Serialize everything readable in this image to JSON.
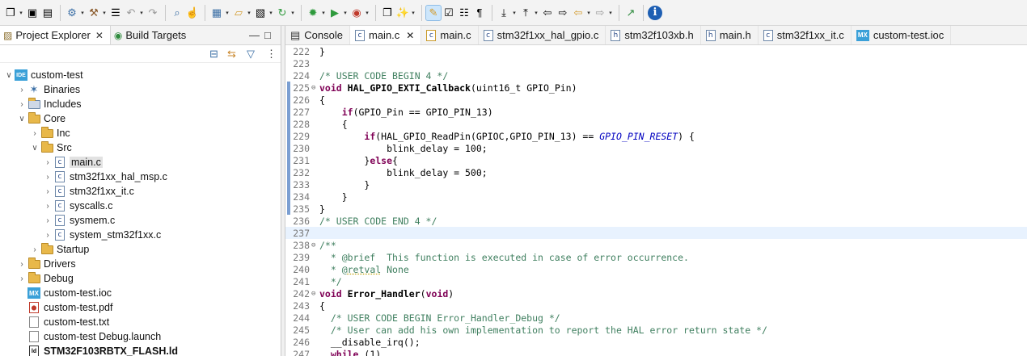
{
  "toolbar": {
    "buttons": [
      {
        "icon": "new-icon",
        "glyph": "❐",
        "arrow": true
      },
      {
        "icon": "save-icon",
        "glyph": "▣"
      },
      {
        "icon": "save-all-icon",
        "glyph": "▤"
      },
      {
        "sep": true
      },
      {
        "icon": "settings-icon",
        "glyph": "⚙",
        "arrow": true
      },
      {
        "icon": "build-icon",
        "glyph": "⚒",
        "arrow": true
      },
      {
        "icon": "binary-icon",
        "glyph": "☰"
      },
      {
        "icon": "undo-icon",
        "glyph": "↶",
        "arrow": true
      },
      {
        "icon": "redo-icon",
        "glyph": "↷"
      },
      {
        "sep": true
      },
      {
        "icon": "search-icon",
        "glyph": "⌕"
      },
      {
        "icon": "hand-icon",
        "glyph": "☝"
      },
      {
        "sep": true
      },
      {
        "icon": "new-project-icon",
        "glyph": "▦",
        "arrow": true
      },
      {
        "icon": "open-folder-icon",
        "glyph": "▱",
        "arrow": true
      },
      {
        "icon": "new-file-icon",
        "glyph": "▧",
        "arrow": true
      },
      {
        "icon": "refresh-icon",
        "glyph": "↻",
        "arrow": true
      },
      {
        "sep": true
      },
      {
        "icon": "debug-icon",
        "glyph": "✹",
        "arrow": true
      },
      {
        "icon": "run-icon",
        "glyph": "▶",
        "arrow": true
      },
      {
        "icon": "run-external-icon",
        "glyph": "◉",
        "arrow": true
      },
      {
        "sep": true
      },
      {
        "icon": "open-task-icon",
        "glyph": "❐"
      },
      {
        "icon": "wand-icon",
        "glyph": "✨",
        "arrow": true
      },
      {
        "sep": true
      },
      {
        "icon": "highlight-icon",
        "glyph": "✎",
        "active": true
      },
      {
        "icon": "mark-icon",
        "glyph": "☑"
      },
      {
        "icon": "block-icon",
        "glyph": "☷"
      },
      {
        "icon": "pilcrow-icon",
        "glyph": "¶"
      },
      {
        "sep": true
      },
      {
        "icon": "next-annotation-icon",
        "glyph": "⤓",
        "arrow": true
      },
      {
        "icon": "prev-annotation-icon",
        "glyph": "⤒",
        "arrow": true
      },
      {
        "icon": "last-edit-icon",
        "glyph": "⇦"
      },
      {
        "icon": "forward-edit-icon",
        "glyph": "⇨"
      },
      {
        "icon": "back-icon",
        "glyph": "⇦",
        "arrow": true
      },
      {
        "icon": "forward-icon",
        "glyph": "⇨",
        "arrow": true
      },
      {
        "sep": true
      },
      {
        "icon": "open-perspective-icon",
        "glyph": "↗"
      },
      {
        "sep": true
      },
      {
        "icon": "info-icon",
        "glyph": "i"
      }
    ]
  },
  "left": {
    "tabs": [
      {
        "label": "Project Explorer",
        "active": true,
        "close": "✕",
        "icon": "project-explorer-icon",
        "glyph": "▨"
      },
      {
        "label": "Build Targets",
        "active": false,
        "icon": "build-targets-icon",
        "glyph": "◉"
      }
    ],
    "minimize": "—",
    "maximize": "□",
    "actions": [
      {
        "icon": "collapse-all-icon",
        "glyph": "⊟"
      },
      {
        "icon": "link-editor-icon",
        "glyph": "⇆"
      },
      {
        "icon": "filter-icon",
        "glyph": "▽"
      },
      {
        "icon": "view-menu-icon",
        "glyph": "⋮"
      }
    ],
    "tree": [
      {
        "label": "custom-test",
        "depth": 0,
        "twisty": "⌵",
        "type": "ide"
      },
      {
        "label": "Binaries",
        "depth": 1,
        "twisty": "›",
        "type": "bin"
      },
      {
        "label": "Includes",
        "depth": 1,
        "twisty": "›",
        "type": "inc"
      },
      {
        "label": "Core",
        "depth": 1,
        "twisty": "⌵",
        "type": "folder"
      },
      {
        "label": "Inc",
        "depth": 2,
        "twisty": "›",
        "type": "folder"
      },
      {
        "label": "Src",
        "depth": 2,
        "twisty": "⌵",
        "type": "folder"
      },
      {
        "label": "main.c",
        "depth": 3,
        "twisty": "›",
        "type": "c",
        "selected": true
      },
      {
        "label": "stm32f1xx_hal_msp.c",
        "depth": 3,
        "twisty": "›",
        "type": "c"
      },
      {
        "label": "stm32f1xx_it.c",
        "depth": 3,
        "twisty": "›",
        "type": "c"
      },
      {
        "label": "syscalls.c",
        "depth": 3,
        "twisty": "›",
        "type": "c"
      },
      {
        "label": "sysmem.c",
        "depth": 3,
        "twisty": "›",
        "type": "c"
      },
      {
        "label": "system_stm32f1xx.c",
        "depth": 3,
        "twisty": "›",
        "type": "c"
      },
      {
        "label": "Startup",
        "depth": 2,
        "twisty": "›",
        "type": "folder"
      },
      {
        "label": "Drivers",
        "depth": 1,
        "twisty": "›",
        "type": "folder"
      },
      {
        "label": "Debug",
        "depth": 1,
        "twisty": "›",
        "type": "folder"
      },
      {
        "label": "custom-test.ioc",
        "depth": 1,
        "twisty": "",
        "type": "mx"
      },
      {
        "label": "custom-test.pdf",
        "depth": 1,
        "twisty": "",
        "type": "pdf"
      },
      {
        "label": "custom-test.txt",
        "depth": 1,
        "twisty": "",
        "type": "doc"
      },
      {
        "label": "custom-test Debug.launch",
        "depth": 1,
        "twisty": "",
        "type": "doc"
      },
      {
        "label": "STM32F103RBTX_FLASH.ld",
        "depth": 1,
        "twisty": "",
        "type": "ld",
        "bold": true
      }
    ]
  },
  "editor": {
    "tabs": [
      {
        "label": "Console",
        "type": "console"
      },
      {
        "label": "main.c",
        "type": "c",
        "active": true,
        "close": "✕"
      },
      {
        "label": "main.c",
        "type": "c-warn"
      },
      {
        "label": "stm32f1xx_hal_gpio.c",
        "type": "c"
      },
      {
        "label": "stm32f103xb.h",
        "type": "h"
      },
      {
        "label": "main.h",
        "type": "h"
      },
      {
        "label": "stm32f1xx_it.c",
        "type": "c"
      },
      {
        "label": "custom-test.ioc",
        "type": "mx"
      }
    ],
    "lines": [
      {
        "n": "222",
        "segs": [
          [
            "",
            "}"
          ]
        ]
      },
      {
        "n": "223",
        "segs": [
          [
            "",
            ""
          ]
        ]
      },
      {
        "n": "224",
        "segs": [
          [
            "cm",
            "/* USER CODE BEGIN 4 */"
          ]
        ]
      },
      {
        "n": "225",
        "fold": "⊖",
        "chg": true,
        "segs": [
          [
            "kw",
            "void"
          ],
          [
            "",
            " "
          ],
          [
            "fn",
            "HAL_GPIO_EXTI_Callback"
          ],
          [
            "",
            "(uint16_t GPIO_Pin)"
          ]
        ]
      },
      {
        "n": "226",
        "chg": true,
        "segs": [
          [
            "",
            "{"
          ]
        ]
      },
      {
        "n": "227",
        "chg": true,
        "segs": [
          [
            "",
            "    "
          ],
          [
            "kw",
            "if"
          ],
          [
            "",
            "(GPIO_Pin == GPIO_PIN_13)"
          ]
        ]
      },
      {
        "n": "228",
        "chg": true,
        "segs": [
          [
            "",
            "    {"
          ]
        ]
      },
      {
        "n": "229",
        "chg": true,
        "segs": [
          [
            "",
            "        "
          ],
          [
            "kw",
            "if"
          ],
          [
            "",
            "(HAL_GPIO_ReadPin(GPIOC,GPIO_PIN_13) == "
          ],
          [
            "mac",
            "GPIO_PIN_RESET"
          ],
          [
            "",
            ") {"
          ]
        ]
      },
      {
        "n": "230",
        "chg": true,
        "segs": [
          [
            "",
            "            blink_delay = 100;"
          ]
        ]
      },
      {
        "n": "231",
        "chg": true,
        "segs": [
          [
            "",
            "        }"
          ],
          [
            "kw",
            "else"
          ],
          [
            "",
            "{"
          ]
        ]
      },
      {
        "n": "232",
        "chg": true,
        "segs": [
          [
            "",
            "            blink_delay = 500;"
          ]
        ]
      },
      {
        "n": "233",
        "chg": true,
        "segs": [
          [
            "",
            "        }"
          ]
        ]
      },
      {
        "n": "234",
        "chg": true,
        "segs": [
          [
            "",
            "    }"
          ]
        ]
      },
      {
        "n": "235",
        "chg": true,
        "segs": [
          [
            "",
            "}"
          ]
        ]
      },
      {
        "n": "236",
        "segs": [
          [
            "cm",
            "/* USER CODE END 4 */"
          ]
        ]
      },
      {
        "n": "237",
        "hl": true,
        "segs": [
          [
            "",
            ""
          ]
        ]
      },
      {
        "n": "238",
        "fold": "⊖",
        "segs": [
          [
            "cm",
            "/**"
          ]
        ]
      },
      {
        "n": "239",
        "segs": [
          [
            "cm",
            "  * @brief  This function is executed in case of error occurrence."
          ]
        ]
      },
      {
        "n": "240",
        "segs": [
          [
            "cm",
            "  * @"
          ],
          [
            "cm ul",
            "retval"
          ],
          [
            "cm",
            " None"
          ]
        ]
      },
      {
        "n": "241",
        "segs": [
          [
            "cm",
            "  */"
          ]
        ]
      },
      {
        "n": "242",
        "fold": "⊖",
        "segs": [
          [
            "kw",
            "void"
          ],
          [
            "",
            " "
          ],
          [
            "fn",
            "Error_Handler"
          ],
          [
            "",
            "("
          ],
          [
            "kw",
            "void"
          ],
          [
            "",
            ")"
          ]
        ]
      },
      {
        "n": "243",
        "segs": [
          [
            "",
            "{"
          ]
        ]
      },
      {
        "n": "244",
        "segs": [
          [
            "",
            "  "
          ],
          [
            "cm",
            "/* USER CODE BEGIN Error_Handler_Debug */"
          ]
        ]
      },
      {
        "n": "245",
        "segs": [
          [
            "",
            "  "
          ],
          [
            "cm",
            "/* User can add his own implementation to report the HAL error return state */"
          ]
        ]
      },
      {
        "n": "246",
        "segs": [
          [
            "",
            "  __disable_irq();"
          ]
        ]
      },
      {
        "n": "247",
        "segs": [
          [
            "",
            "  "
          ],
          [
            "kw",
            "while"
          ],
          [
            "",
            " (1)"
          ]
        ]
      }
    ]
  }
}
